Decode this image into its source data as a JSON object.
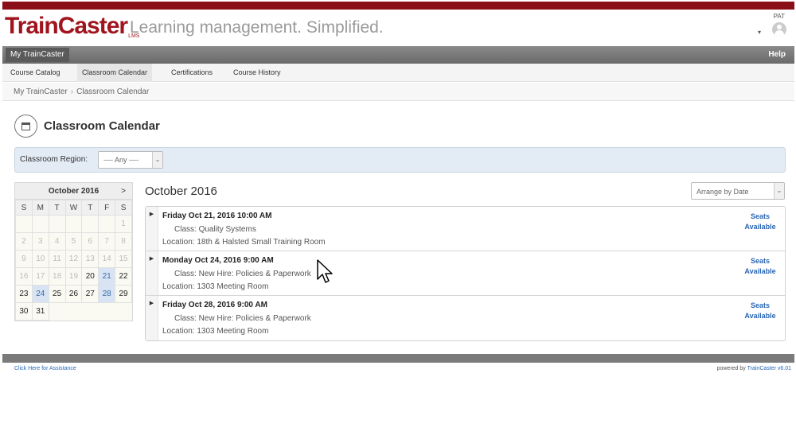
{
  "header": {
    "logo_text": "TrainCaster",
    "logo_sub": "LMS",
    "tagline": "Learning management. Simplified.",
    "user_name": "PAT",
    "user_caret": "▾"
  },
  "mainbar": {
    "home_label": "My TrainCaster",
    "help_label": "Help"
  },
  "subnav": {
    "items": [
      "Course Catalog",
      "Classroom Calendar",
      "Certifications",
      "Course History"
    ]
  },
  "breadcrumb": {
    "root": "My TrainCaster",
    "sep": "›",
    "current": "Classroom Calendar"
  },
  "page": {
    "title": "Classroom Calendar"
  },
  "filter": {
    "label": "Classroom Region:",
    "value": "---- Any ----"
  },
  "mini_calendar": {
    "month_label": "October 2016",
    "next_label": ">",
    "dow": [
      "S",
      "M",
      "T",
      "W",
      "T",
      "F",
      "S"
    ],
    "weeks": [
      [
        "",
        "",
        "",
        "",
        "",
        "",
        "1"
      ],
      [
        "2",
        "3",
        "4",
        "5",
        "6",
        "7",
        "8"
      ],
      [
        "9",
        "10",
        "11",
        "12",
        "13",
        "14",
        "15"
      ],
      [
        "16",
        "17",
        "18",
        "19",
        "20",
        "21",
        "22"
      ],
      [
        "23",
        "24",
        "25",
        "26",
        "27",
        "28",
        "29"
      ],
      [
        "30",
        "31",
        "",
        "",
        "",
        "",
        ""
      ]
    ]
  },
  "main": {
    "month_title": "October 2016",
    "sort_value": "Arrange by Date",
    "events": [
      {
        "date": "Friday Oct 21, 2016 10:00 AM",
        "class_label": "Class:",
        "class_name": "Quality Systems",
        "location_label": "Location:",
        "location": "18th & Halsted Small Training Room",
        "seats_line1": "Seats",
        "seats_line2": "Available"
      },
      {
        "date": "Monday Oct 24, 2016 9:00 AM",
        "class_label": "Class:",
        "class_name": "New Hire: Policies & Paperwork",
        "location_label": "Location:",
        "location": "1303 Meeting Room",
        "seats_line1": "Seats",
        "seats_line2": "Available"
      },
      {
        "date": "Friday Oct 28, 2016 9:00 AM",
        "class_label": "Class:",
        "class_name": "New Hire: Policies & Paperwork",
        "location_label": "Location:",
        "location": "1303 Meeting Room",
        "seats_line1": "Seats",
        "seats_line2": "Available"
      }
    ]
  },
  "footer": {
    "assist_link": "Click Here for Assistance",
    "powered_prefix": "powered by",
    "powered_brand": "TrainCaster v6.01"
  },
  "icons": {
    "expander": "▶",
    "select_arrow": "⌄"
  },
  "colors": {
    "brand_red": "#a0141e",
    "link_blue": "#2a67b3",
    "highlight_blue": "#d8e4f3"
  }
}
